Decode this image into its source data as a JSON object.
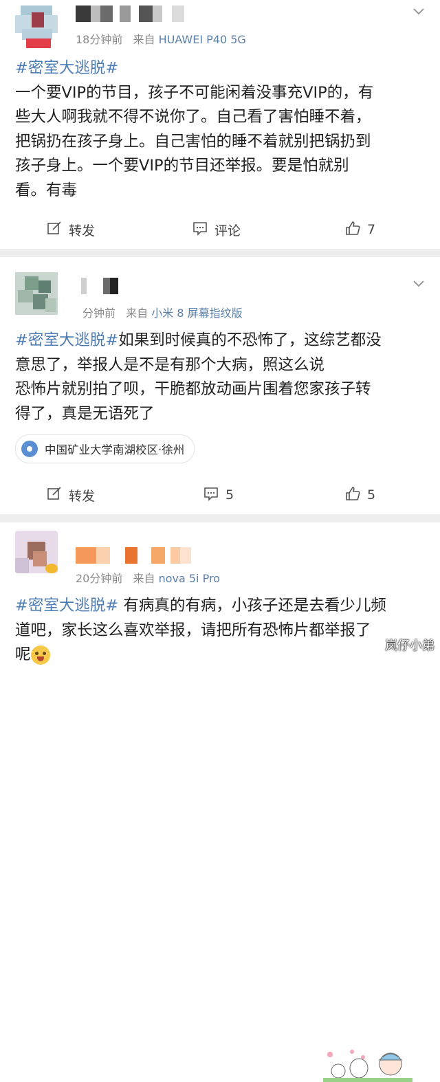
{
  "posts": [
    {
      "username_redacted": true,
      "time": "18分钟前",
      "from_label": "来自",
      "source": "HUAWEI P40 5G",
      "hashtag": "#密室大逃脱#",
      "lines": [
        "一个要VIP的节目，孩子不可能闲着没事充VIP的，有",
        "些大人啊我就不得不说你了。自己看了害怕睡不着，",
        "把锅扔在孩子身上。自己害怕的睡不着就别把锅扔到",
        "孩子身上。一个要VIP的节目还举报。要是怕就别",
        "看。有毒"
      ],
      "actions": {
        "repost": "转发",
        "comment": "评论",
        "like": "7"
      }
    },
    {
      "username_redacted": true,
      "time": "分钟前",
      "from_label": "来自",
      "source": "小米 8 屏幕指纹版",
      "hashtag": "#密室大逃脱#",
      "lines": [
        "如果到时候真的不恐怖了，这综艺都没",
        "意思了，举报人是不是有那个大病，照这么说",
        "恐怖片就别拍了呗，干脆都放动画片围着您家孩子转",
        "得了，真是无语死了"
      ],
      "location": "中国矿业大学南湖校区·徐州",
      "actions": {
        "repost": "转发",
        "comment": "5",
        "like": "5"
      }
    },
    {
      "username_redacted": true,
      "time": "20分钟前",
      "from_label": "来自",
      "source": "nova 5i Pro",
      "hashtag": "#密室大逃脱#",
      "lines": [
        " 有病真的有病，小孩子还是去看少儿频",
        "道吧，家长这么喜欢举报，请把所有恐怖片都举报了",
        "呢"
      ]
    }
  ],
  "watermark": "岚仔小弟",
  "colors": {
    "link": "#4f7db5",
    "source": "#5b7fa8",
    "meta": "#8a8a8a",
    "separator": "#eeeeee"
  },
  "icons": {
    "repost": "edit-share-icon",
    "comment": "comment-icon",
    "like": "thumbs-up-icon",
    "chevron": "chevron-down-icon",
    "location": "location-pin-icon"
  }
}
